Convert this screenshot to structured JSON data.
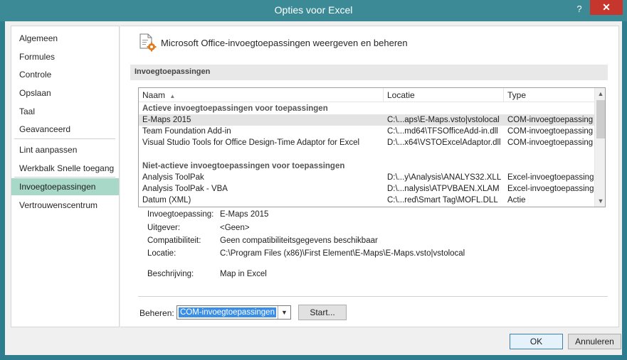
{
  "window": {
    "title": "Opties voor Excel",
    "help": "?",
    "close": "✕"
  },
  "sidebar": {
    "items": [
      {
        "label": "Algemeen"
      },
      {
        "label": "Formules"
      },
      {
        "label": "Controle"
      },
      {
        "label": "Opslaan"
      },
      {
        "label": "Taal"
      },
      {
        "label": "Geavanceerd"
      },
      {
        "label": "Lint aanpassen"
      },
      {
        "label": "Werkbalk Snelle toegang"
      },
      {
        "label": "Invoegtoepassingen"
      },
      {
        "label": "Vertrouwenscentrum"
      }
    ],
    "active_index": 8
  },
  "main": {
    "header_title": "Microsoft Office-invoegtoepassingen weergeven en beheren",
    "section_title": "Invoegtoepassingen"
  },
  "list": {
    "columns": [
      "Naam",
      "Locatie",
      "Type"
    ],
    "sort_indicator": "▲",
    "group_active": "Actieve invoegtoepassingen voor toepassingen",
    "group_inactive": "Niet-actieve invoegtoepassingen voor toepassingen",
    "active_rows": [
      {
        "name": "E-Maps 2015",
        "location": "C:\\...aps\\E-Maps.vsto|vstolocal",
        "type": "COM-invoegtoepassing"
      },
      {
        "name": "Team Foundation Add-in",
        "location": "C:\\...md64\\TFSOfficeAdd-in.dll",
        "type": "COM-invoegtoepassing"
      },
      {
        "name": "Visual Studio Tools for Office Design-Time Adaptor for Excel",
        "location": "D:\\...x64\\VSTOExcelAdaptor.dll",
        "type": "COM-invoegtoepassing"
      }
    ],
    "inactive_rows": [
      {
        "name": "Analysis ToolPak",
        "location": "D:\\...y\\Analysis\\ANALYS32.XLL",
        "type": "Excel-invoegtoepassing"
      },
      {
        "name": "Analysis ToolPak - VBA",
        "location": "D:\\...nalysis\\ATPVBAEN.XLAM",
        "type": "Excel-invoegtoepassing"
      },
      {
        "name": "Datum (XML)",
        "location": "C:\\...red\\Smart Tag\\MOFL.DLL",
        "type": "Actie"
      }
    ],
    "scroll_up": "▲",
    "scroll_down": "▼"
  },
  "details": {
    "addin_label": "Invoegtoepassing:",
    "addin_value": "E-Maps 2015",
    "publisher_label": "Uitgever:",
    "publisher_value": "<Geen>",
    "compat_label": "Compatibiliteit:",
    "compat_value": "Geen compatibiliteitsgegevens beschikbaar",
    "location_label": "Locatie:",
    "location_value": "C:\\Program Files (x86)\\First Element\\E-Maps\\E-Maps.vsto|vstolocal",
    "description_label": "Beschrijving:",
    "description_value": "Map in Excel"
  },
  "manage": {
    "label": "Beheren:",
    "selected": "COM-invoegtoepassingen",
    "arrow": "▼",
    "start_button": "Start..."
  },
  "footer": {
    "ok": "OK",
    "cancel": "Annuleren"
  },
  "colors": {
    "titlebar": "#3b8a96",
    "close": "#c7362c",
    "active_sidebar": "#a8d8c8",
    "select_highlight": "#3a8ee6"
  }
}
